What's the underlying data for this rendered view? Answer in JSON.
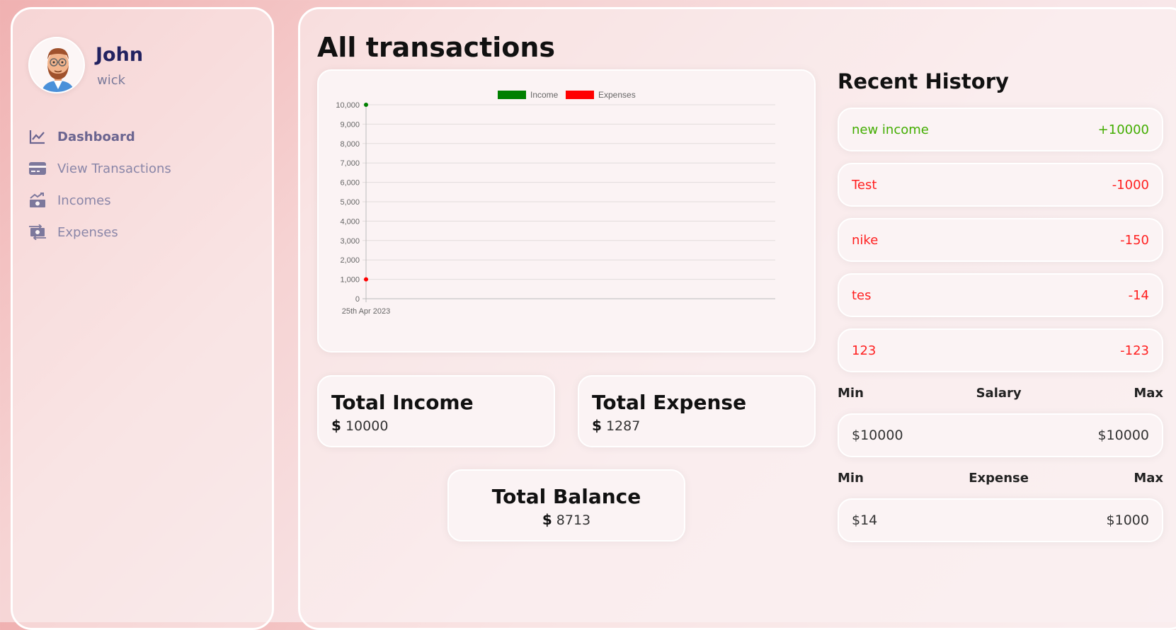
{
  "user": {
    "name": "John",
    "subtitle": "wick"
  },
  "nav": [
    {
      "label": "Dashboard",
      "icon": "chart-line-icon",
      "active": true
    },
    {
      "label": "View Transactions",
      "icon": "credit-card-icon",
      "active": false
    },
    {
      "label": "Incomes",
      "icon": "money-trend-icon",
      "active": false
    },
    {
      "label": "Expenses",
      "icon": "money-exchange-icon",
      "active": false
    }
  ],
  "page": {
    "title": "All transactions"
  },
  "chart_data": {
    "type": "line",
    "x": [
      "25th Apr 2023"
    ],
    "series": [
      {
        "name": "Income",
        "values": [
          10000
        ],
        "color": "#008000"
      },
      {
        "name": "Expenses",
        "values": [
          1000
        ],
        "color": "#ff0000"
      }
    ],
    "ylim": [
      0,
      10000
    ],
    "yticks": [
      "0",
      "1,000",
      "2,000",
      "3,000",
      "4,000",
      "5,000",
      "6,000",
      "7,000",
      "8,000",
      "9,000",
      "10,000"
    ],
    "grid": true,
    "legend": "top-center"
  },
  "totals": {
    "income_title": "Total Income",
    "income_currency": "$",
    "income_value": "10000",
    "expense_title": "Total Expense",
    "expense_currency": "$",
    "expense_value": "1287",
    "balance_title": "Total Balance",
    "balance_currency": "$",
    "balance_value": "8713"
  },
  "history": {
    "title": "Recent History",
    "items": [
      {
        "name": "new income",
        "amount": "+10000",
        "type": "income"
      },
      {
        "name": "Test",
        "amount": "-1000",
        "type": "expense"
      },
      {
        "name": "nike",
        "amount": "-150",
        "type": "expense"
      },
      {
        "name": "tes",
        "amount": "-14",
        "type": "expense"
      },
      {
        "name": "123",
        "amount": "-123",
        "type": "expense"
      }
    ]
  },
  "salary": {
    "min_label": "Min",
    "title": "Salary",
    "max_label": "Max",
    "min_value": "$10000",
    "max_value": "$10000"
  },
  "expense_range": {
    "min_label": "Min",
    "title": "Expense",
    "max_label": "Max",
    "min_value": "$14",
    "max_value": "$1000"
  },
  "colors": {
    "income": "#42ad00",
    "expense": "#ff0000",
    "title_dark": "#222260"
  }
}
